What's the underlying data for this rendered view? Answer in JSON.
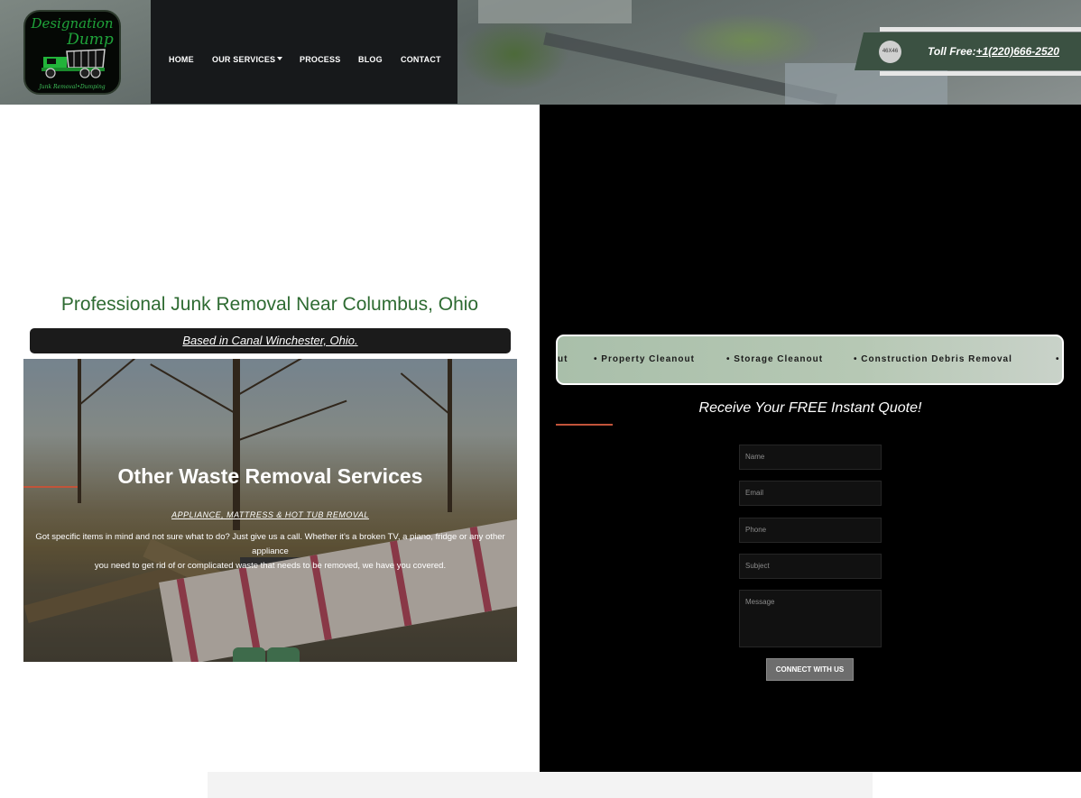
{
  "logo": {
    "line1": "Designation",
    "line2": "Dump",
    "tagline": "Junk Removal•Dumping"
  },
  "nav": {
    "items": [
      "HOME",
      "OUR SERVICES",
      "PROCESS",
      "BLOG",
      "CONTACT"
    ]
  },
  "phone": {
    "avatar": "46X46",
    "label": "Toll Free:",
    "number": "+1(220)666-2520"
  },
  "left": {
    "title": "Professional Junk Removal Near Columbus, Ohio",
    "based": "Based in Canal Winchester, Ohio.",
    "card": {
      "title": "Other Waste Removal Services",
      "subtitle": "APPLIANCE, MATTRESS & HOT TUB REMOVAL",
      "body_line1": "Got specific items in mind and not sure what to do? Just give us a call. Whether it's a broken TV, a piano, fridge or any other appliance",
      "body_line2": "you need to get rid of or complicated waste that needs to be removed, we have you covered."
    }
  },
  "marquee": {
    "items": [
      "ut",
      "• Property Cleanout",
      "• Storage Cleanout",
      "• Construction Debris Removal",
      "• A"
    ]
  },
  "quote": {
    "title": "Receive Your FREE Instant Quote!",
    "fields": {
      "name": "Name",
      "email": "Email",
      "phone": "Phone",
      "subject": "Subject",
      "message": "Message"
    },
    "button": "CONNECT WITH US"
  },
  "colors": {
    "brand_green": "#2e6b32",
    "accent": "#c2543a",
    "nav_bg": "#17191b",
    "phone_bg": "#3b5142"
  }
}
